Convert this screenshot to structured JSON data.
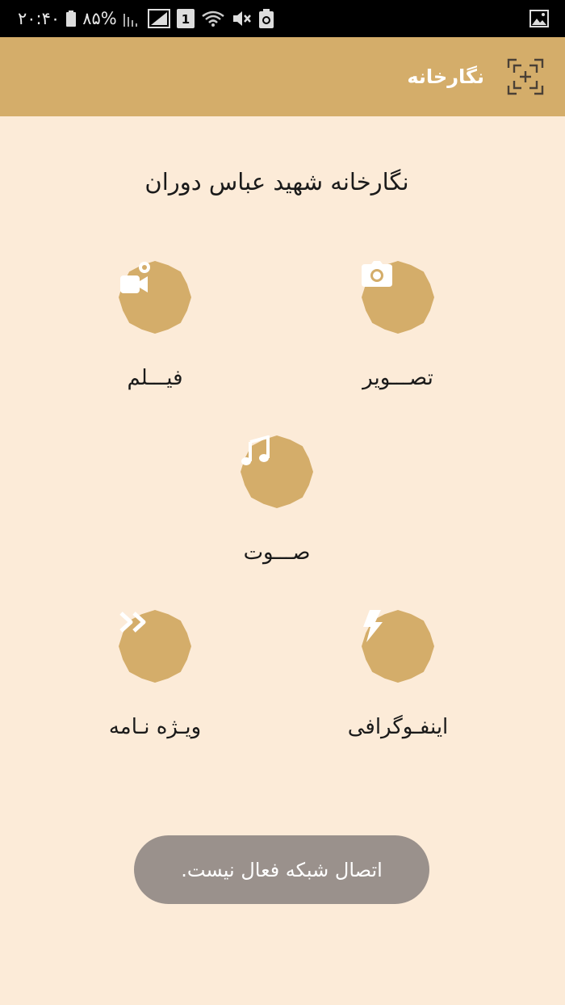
{
  "status_bar": {
    "time": "۲۰:۴۰",
    "battery": "۸۵%",
    "sim_label": "1",
    "icons": [
      "battery-icon",
      "signal-icon",
      "signal-box-icon",
      "sim-icon",
      "wifi-icon",
      "mute-icon",
      "recycle-icon",
      "gallery-icon"
    ]
  },
  "app_bar": {
    "title": "نگارخانه",
    "logo_icon": "focus-frame-icon"
  },
  "main": {
    "title": "نگارخانه شهید عباس دوران",
    "menu_items": [
      {
        "label": "تصـــویر",
        "icon": "camera-icon"
      },
      {
        "label": "فیـــلم",
        "icon": "video-camera-icon"
      },
      {
        "label": "صـــوت",
        "icon": "music-note-icon"
      },
      {
        "label": "اینفـوگرافی",
        "icon": "lightning-icon"
      },
      {
        "label": "ویـژه نـامه",
        "icon": "fast-forward-icon"
      }
    ]
  },
  "toast": {
    "message": "اتصال شبکه فعال نیست."
  },
  "colors": {
    "background": "#fcebd8",
    "accent": "#d4ad6a",
    "toast": "#9a918c"
  }
}
